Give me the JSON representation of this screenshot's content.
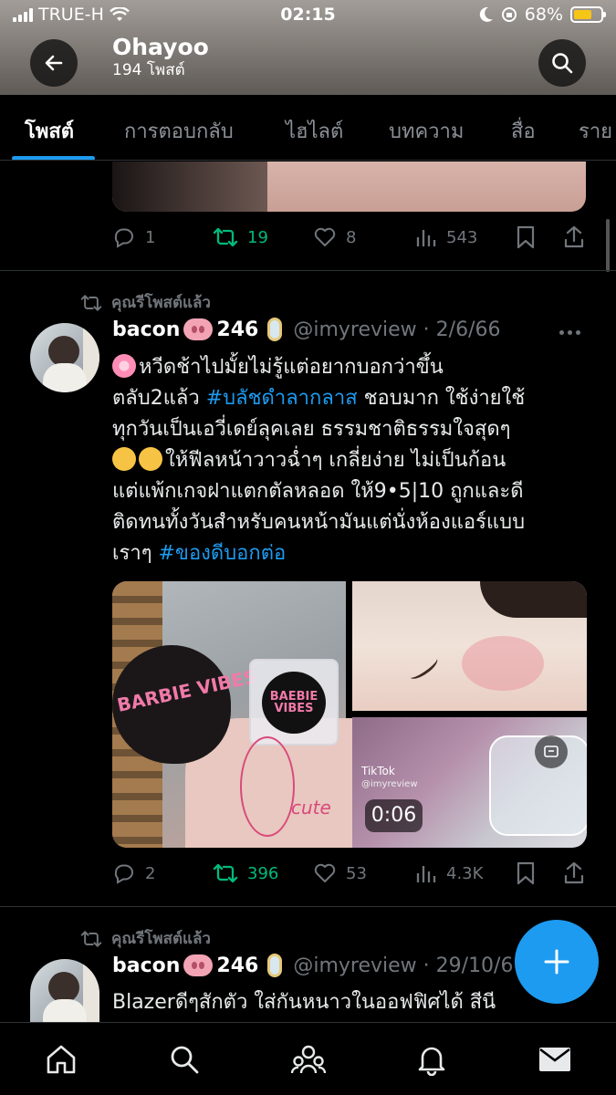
{
  "status_bar": {
    "carrier": "TRUE-H",
    "time": "02:15",
    "battery": "68%"
  },
  "header": {
    "title": "Ohayoo",
    "subtitle": "194 โพสต์"
  },
  "tabs": [
    {
      "label": "โพสต์",
      "active": true
    },
    {
      "label": "การตอบกลับ"
    },
    {
      "label": "ไฮไลต์"
    },
    {
      "label": "บทความ"
    },
    {
      "label": "สื่อ"
    },
    {
      "label": "ราย"
    }
  ],
  "prev_tweet": {
    "replies": "1",
    "reposts": "19",
    "likes": "8",
    "views": "543"
  },
  "tweet1": {
    "repost_label": "คุณรีโพสต์แล้ว",
    "name": "bacon",
    "name_suffix": "246",
    "handle": "@imyreview · 2/6/66",
    "text_lines": [
      {
        "pre": "หวีดช้าไปมั้ยไม่รู้แต่อยากบอกว่าขึ้น"
      },
      {
        "pre": "ตลับ2แล้ว ",
        "tag": "#บลัชดำลากลาส",
        "post": " ชอบมาก ใช้ง่ายใช้"
      },
      {
        "pre": "ทุกวันเป็นเอวี่เดย์ลุคเลย ธรรมชาติธรรมใจสุดๆ"
      },
      {
        "pre": "ให้ฟีลหน้าวาวฉ่ำๆ เกลี่ยง่าย ไม่เป็นก้อน"
      },
      {
        "pre": "แต่แพ้กเกจฝาแตกตัลหลอด ให้9•5|10 ถูกและดี"
      },
      {
        "pre": "ติดทนทั้งวันสำหรับคนหน้ามันแต่นั่งห้องแอร์แบบ"
      },
      {
        "pre": "เราๆ ",
        "tag": "#ของดีบอกต่อ"
      }
    ],
    "media": {
      "puff_text": "BARBIE VIBES",
      "compact_logo": "BAEBIE",
      "compact_logo_sub": "VIBES",
      "annotation": "cute",
      "tiktok_label": "TikTok",
      "tiktok_handle": "@imyreview",
      "video_duration": "0:06"
    },
    "replies": "2",
    "reposts": "396",
    "likes": "53",
    "views": "4.3K"
  },
  "tweet2": {
    "repost_label": "คุณรีโพสต์แล้ว",
    "name": "bacon",
    "name_suffix": "246",
    "handle": "@imyreview · 29/10/6",
    "text": "Blazerดีๆสักตัว ใส่กันหนาวในออฟฟิศได้ สีนี"
  },
  "nav": [
    "home-icon",
    "search-icon",
    "communities-icon",
    "notifications-icon",
    "messages-icon"
  ],
  "colors": {
    "accent": "#1d9bf0",
    "repost_green": "#00ba7c",
    "muted": "#71767b"
  }
}
